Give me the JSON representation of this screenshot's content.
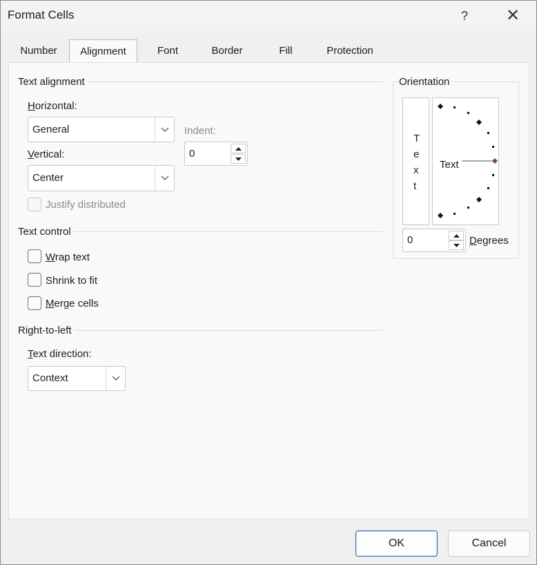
{
  "dialog": {
    "title": "Format Cells",
    "help_glyph": "?",
    "close_glyph": "✕"
  },
  "tabs": [
    "Number",
    "Alignment",
    "Font",
    "Border",
    "Fill",
    "Protection"
  ],
  "active_tab": "Alignment",
  "text_alignment": {
    "heading": "Text alignment",
    "horizontal_label": "Horizontal:",
    "horizontal_value": "General",
    "vertical_label": "Vertical:",
    "vertical_value": "Center",
    "indent_label": "Indent:",
    "indent_value": "0",
    "justify_distributed_label": "Justify distributed"
  },
  "text_control": {
    "heading": "Text control",
    "wrap_text": "Wrap text",
    "shrink_to_fit": "Shrink to fit",
    "merge_cells": "Merge cells"
  },
  "right_to_left": {
    "heading": "Right-to-left",
    "text_direction_label": "Text direction:",
    "text_direction_value": "Context"
  },
  "orientation": {
    "heading": "Orientation",
    "vertical_text_letters": [
      "T",
      "e",
      "x",
      "t"
    ],
    "dial_text": "Text",
    "degrees_value": "0",
    "degrees_label": "Degrees"
  },
  "footer": {
    "ok": "OK",
    "cancel": "Cancel"
  },
  "colors": {
    "accent_border": "#2d6fb8",
    "dial_handle": "#7a4a30"
  }
}
